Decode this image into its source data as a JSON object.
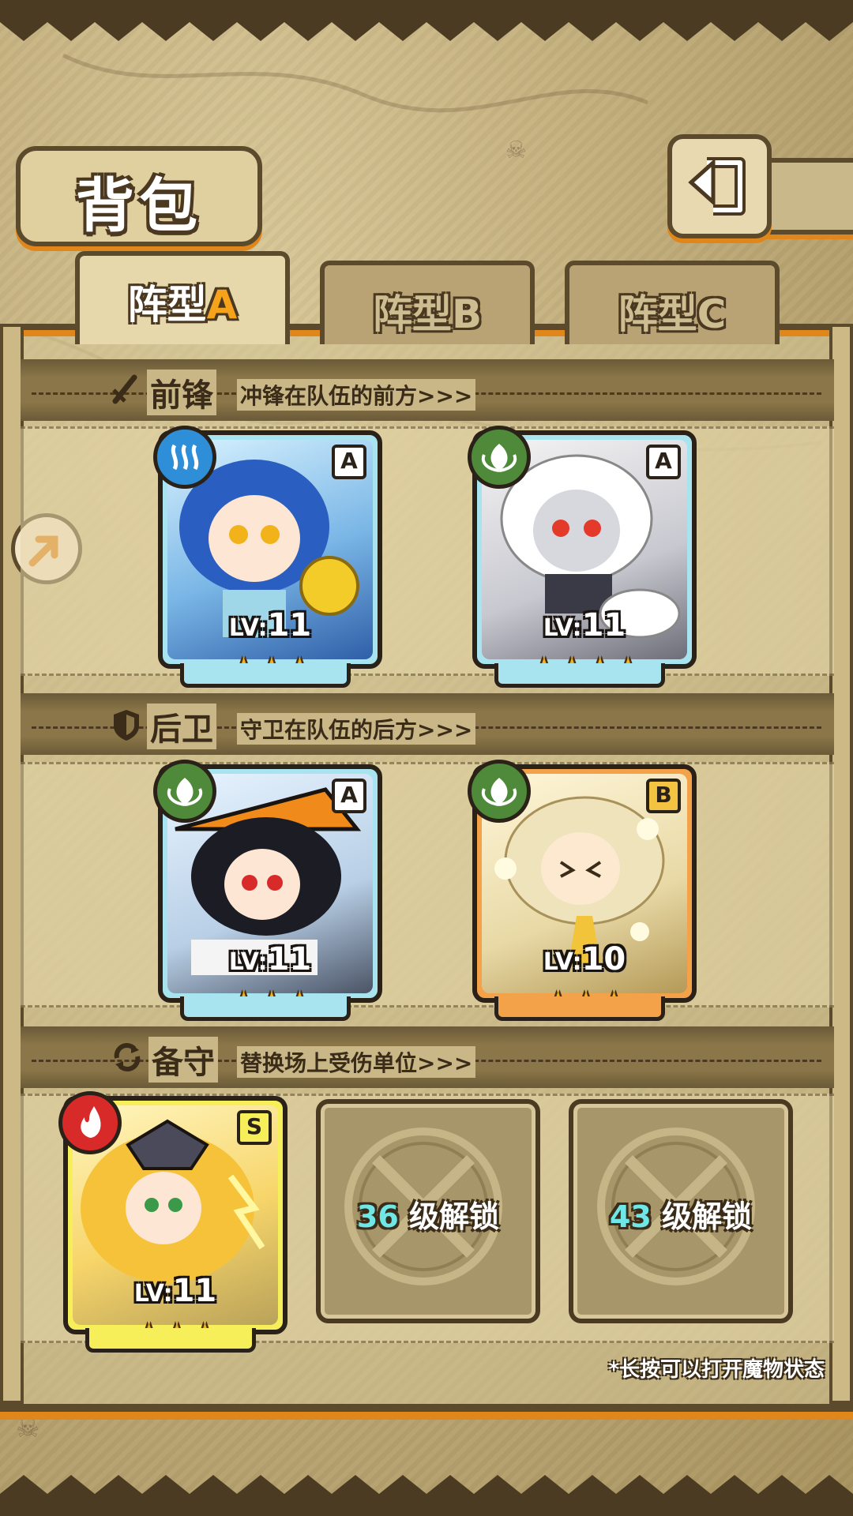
{
  "header": {
    "title": "背包",
    "back_icon": "return-arrow-icon"
  },
  "tabs": [
    {
      "prefix": "阵型",
      "letter": "A",
      "active": true
    },
    {
      "prefix": "阵型",
      "letter": "B",
      "active": false
    },
    {
      "prefix": "阵型",
      "letter": "C",
      "active": false
    }
  ],
  "sections": {
    "front": {
      "icon": "sword-icon",
      "title": "前锋",
      "subtitle": "冲锋在队伍的前方>>>"
    },
    "back": {
      "icon": "shield-icon",
      "title": "后卫",
      "subtitle": "守卫在队伍的后方>>>"
    },
    "reserve": {
      "icon": "swap-icon",
      "title": "备守",
      "subtitle": "替换场上受伤单位>>>"
    }
  },
  "units": {
    "front": [
      {
        "element": "water",
        "rank": "A",
        "lv_prefix": "LV:",
        "lv": "11",
        "stars": "★★★",
        "frame": "blue"
      },
      {
        "element": "leaf",
        "rank": "A",
        "lv_prefix": "LV:",
        "lv": "11",
        "stars": "★★★★",
        "frame": "blue"
      }
    ],
    "back": [
      {
        "element": "leaf",
        "rank": "A",
        "lv_prefix": "LV:",
        "lv": "11",
        "stars": "★★★",
        "frame": "blue"
      },
      {
        "element": "leaf",
        "rank": "B",
        "lv_prefix": "LV:",
        "lv": "10",
        "stars": "★★★",
        "frame": "orange"
      }
    ],
    "reserve": [
      {
        "element": "fire",
        "rank": "S",
        "lv_prefix": "LV:",
        "lv": "11",
        "stars": "★★★",
        "frame": "yellow"
      }
    ]
  },
  "locked_slots": [
    {
      "level": "36",
      "label": "级解锁"
    },
    {
      "level": "43",
      "label": "级解锁"
    }
  ],
  "footnote": "*长按可以打开魔物状态",
  "colors": {
    "accent_orange": "#e0861a",
    "frame_dark": "#5b4a2c",
    "lock_level": "#6fe7e7",
    "star": "#f6b21a"
  }
}
